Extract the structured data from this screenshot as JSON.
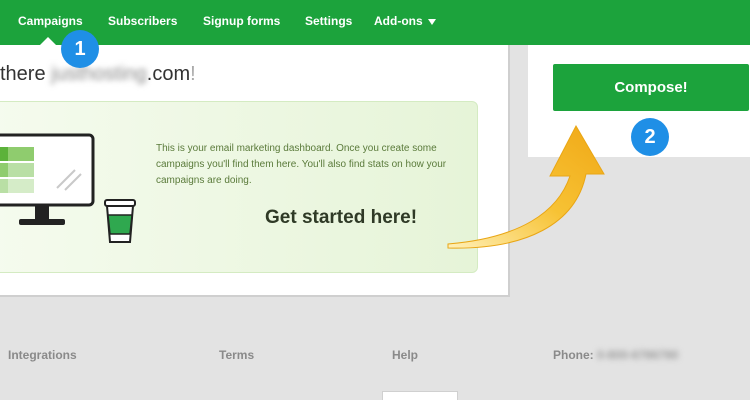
{
  "nav": {
    "items": [
      {
        "label": "Campaigns",
        "active": true
      },
      {
        "label": "Subscribers"
      },
      {
        "label": "Signup forms"
      },
      {
        "label": "Settings"
      },
      {
        "label": "Add-ons",
        "dropdown": true
      }
    ]
  },
  "greeting": {
    "prefix": "there ",
    "name_blurred": "justhosting",
    "suffix": ".com",
    "end": "!"
  },
  "dashboard": {
    "description": "This is your email marketing dashboard. Once you create some campaigns you'll find them here. You'll also find stats on how your campaigns are doing.",
    "cta_label": "Get started here!"
  },
  "compose": {
    "label": "Compose!"
  },
  "badges": {
    "step1": "1",
    "step2": "2"
  },
  "footer": {
    "integrations": "Integrations",
    "terms": "Terms",
    "help": "Help",
    "phone_label": "Phone:",
    "phone_blurred": "0-800-6786780"
  },
  "colors": {
    "brand_green": "#1ca33c",
    "badge_blue": "#1f8fe6",
    "arrow_yellow": "#f7c234"
  },
  "icons": [
    "monitor-icon",
    "coffee-cup-icon",
    "curved-arrow-icon",
    "chevron-down-icon"
  ]
}
